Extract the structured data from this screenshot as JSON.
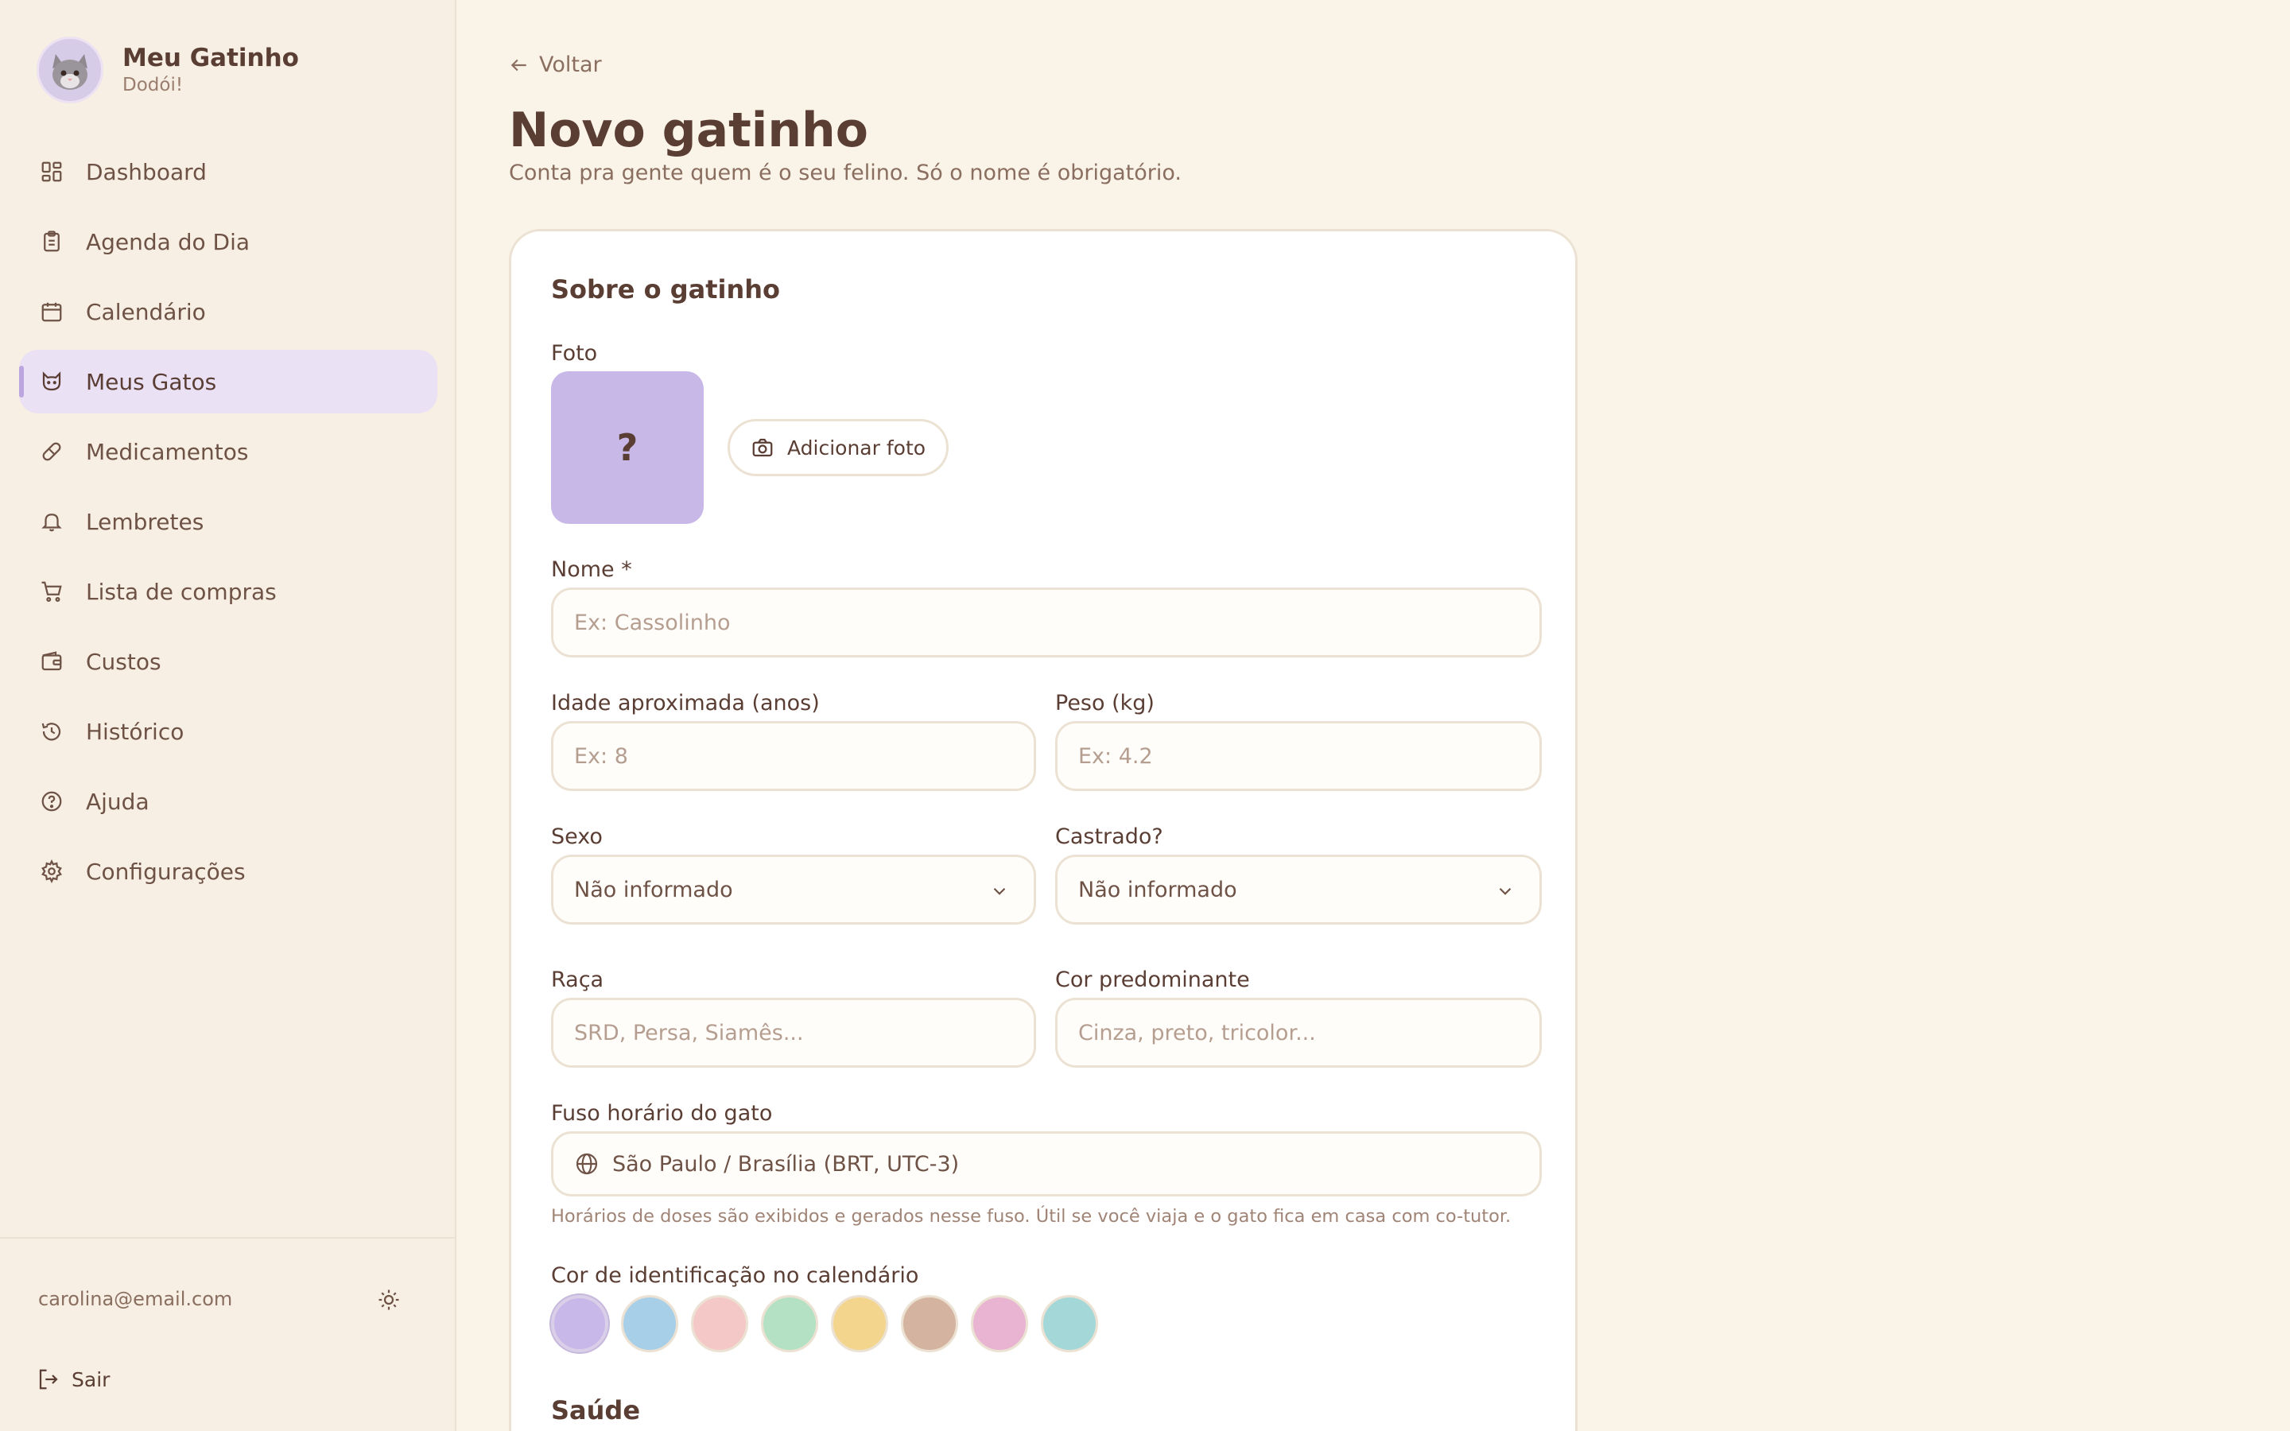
{
  "app": {
    "name": "Meu Gatinho",
    "subtitle": "Dodói!"
  },
  "sidebar": {
    "items": [
      {
        "label": "Dashboard",
        "icon": "dashboard-icon"
      },
      {
        "label": "Agenda do Dia",
        "icon": "clipboard-icon"
      },
      {
        "label": "Calendário",
        "icon": "calendar-icon"
      },
      {
        "label": "Meus Gatos",
        "icon": "cat-icon",
        "active": true
      },
      {
        "label": "Medicamentos",
        "icon": "pill-icon"
      },
      {
        "label": "Lembretes",
        "icon": "bell-icon"
      },
      {
        "label": "Lista de compras",
        "icon": "cart-icon"
      },
      {
        "label": "Custos",
        "icon": "wallet-icon"
      },
      {
        "label": "Histórico",
        "icon": "history-icon"
      },
      {
        "label": "Ajuda",
        "icon": "help-icon"
      },
      {
        "label": "Configurações",
        "icon": "gear-icon"
      }
    ],
    "user_email": "carolina@email.com",
    "logout_label": "Sair"
  },
  "page": {
    "back_label": "Voltar",
    "title": "Novo gatinho",
    "subtitle": "Conta pra gente quem é o seu felino. Só o nome é obrigatório."
  },
  "form": {
    "section_about": "Sobre o gatinho",
    "photo": {
      "label": "Foto",
      "placeholder_glyph": "?",
      "button_label": "Adicionar foto"
    },
    "name": {
      "label": "Nome *",
      "placeholder": "Ex: Cassolinho"
    },
    "age": {
      "label": "Idade aproximada (anos)",
      "placeholder": "Ex: 8"
    },
    "weight": {
      "label": "Peso (kg)",
      "placeholder": "Ex: 4.2"
    },
    "sex": {
      "label": "Sexo",
      "value": "Não informado"
    },
    "neutered": {
      "label": "Castrado?",
      "value": "Não informado"
    },
    "breed": {
      "label": "Raça",
      "placeholder": "SRD, Persa, Siamês..."
    },
    "color": {
      "label": "Cor predominante",
      "placeholder": "Cinza, preto, tricolor..."
    },
    "timezone": {
      "label": "Fuso horário do gato",
      "value": "São Paulo / Brasília (BRT, UTC-3)",
      "hint": "Horários de doses são exibidos e gerados nesse fuso. Útil se você viaja e o gato fica em casa com co-tutor."
    },
    "calendar_color": {
      "label": "Cor de identificação no calendário",
      "options": [
        "#c8b8ea",
        "#a8cfe8",
        "#f5c8c8",
        "#b4e0c4",
        "#f3d58e",
        "#d4b4a0",
        "#e8b4d2",
        "#a4d8d8"
      ],
      "selected_index": 0
    },
    "section_health": "Saúde"
  },
  "colors": {
    "accent": "#bba6e0",
    "background": "#faf3e8",
    "text": "#5a3e34"
  }
}
